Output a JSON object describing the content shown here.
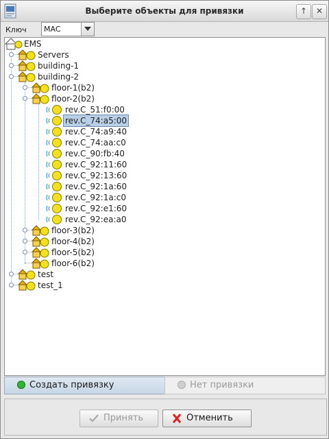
{
  "window": {
    "title": "Выберите объекты для привязки"
  },
  "key": {
    "label": "Ключ",
    "value": "MAC"
  },
  "tree": {
    "root": "EMS",
    "servers": "Servers",
    "building1": "building-1",
    "building2": "building-2",
    "floor1": "floor-1(b2)",
    "floor2": "floor-2(b2)",
    "devices": [
      "rev.C_51:f0:00",
      "rev.C_74:a5:00",
      "rev.C_74:a9:40",
      "rev.C_74:aa:c0",
      "rev.C_90:fb:40",
      "rev.C_92:11:60",
      "rev.C_92:13:60",
      "rev.C_92:1a:60",
      "rev.C_92:1a:c0",
      "rev.C_92:e1:60",
      "rev.C_92:ea:a0"
    ],
    "floor3": "floor-3(b2)",
    "floor4": "floor-4(b2)",
    "floor5": "floor-5(b2)",
    "floor6": "floor-6(b2)",
    "test": "test",
    "test1": "test_1",
    "selected_device": "rev.C_74:a5:00"
  },
  "tabs": {
    "create": "Создать привязку",
    "none": "Нет привязки"
  },
  "buttons": {
    "accept": "Принять",
    "cancel": "Отменить"
  },
  "colors": {
    "selection": "#b8cfe5",
    "active_tab": "#c7d6e6",
    "create_dot": "#2fb52f",
    "cancel_x": "#e02020"
  }
}
